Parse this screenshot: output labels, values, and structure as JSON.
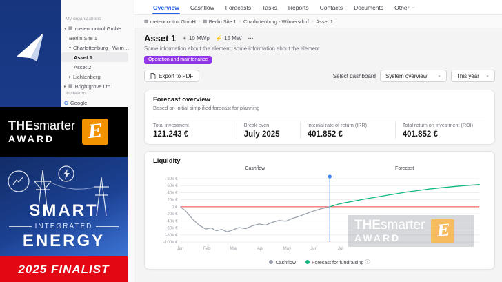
{
  "icons": {
    "building": "▦",
    "sun": "☀",
    "grid": "⚡",
    "more": "⋯",
    "chevron_down": "▾",
    "chevron_right": "▸",
    "caret_down": "⌄",
    "info": "ⓘ",
    "google": "G",
    "separator": "›"
  },
  "colors": {
    "accent": "#2563eb",
    "badge_purple": "#9333ea",
    "brand_blue": "#1e4499",
    "award_orange": "#f39200",
    "award_red": "#e30613",
    "chart_cashflow": "#9ca3af",
    "chart_forecast": "#10b981",
    "chart_today": "#3b82f6",
    "chart_zero": "#ef4444"
  },
  "tabs": {
    "active": "Overview",
    "items": [
      {
        "label": "Overview"
      },
      {
        "label": "Cashflow"
      },
      {
        "label": "Forecasts"
      },
      {
        "label": "Tasks"
      },
      {
        "label": "Reports"
      },
      {
        "label": "Contacts"
      },
      {
        "label": "Documents"
      },
      {
        "label": "Other",
        "caret": true
      }
    ]
  },
  "breadcrumb": {
    "items": [
      {
        "label": "meteocontrol GmbH",
        "icon": "building"
      },
      {
        "label": "Berlin Site 1",
        "icon": "building"
      },
      {
        "label": "Charlottenburg - Wilmersdorf"
      },
      {
        "label": "Asset 1"
      }
    ]
  },
  "sidebar": {
    "sections": [
      {
        "label": "My organizations",
        "items": [
          {
            "label": "meteocontrol GmbH",
            "icon": "building",
            "chevron": "down",
            "level": 0
          },
          {
            "label": "Berlin Site 1",
            "level": 1
          },
          {
            "label": "Charlottenburg - Wilme...",
            "chevron": "down",
            "level": 1
          },
          {
            "label": "Asset 1",
            "level": 2,
            "selected": true
          },
          {
            "label": "Asset 2",
            "level": 2
          },
          {
            "label": "Lichtenberg",
            "chevron": "right",
            "level": 1
          },
          {
            "label": "Brightgrove Ltd.",
            "icon": "building",
            "chevron": "right",
            "level": 0
          }
        ]
      },
      {
        "label": "Invitations",
        "items": [
          {
            "label": "Google",
            "icon": "google",
            "level": 0
          }
        ]
      }
    ]
  },
  "page": {
    "title": "Asset 1",
    "specs": [
      {
        "icon": "sun",
        "label": "10 MWp"
      },
      {
        "icon": "grid",
        "label": "15 MW"
      }
    ],
    "description": "Some information about the element, some information about the element",
    "status_badge": "Operation and maintenance"
  },
  "toolbar": {
    "export_pdf_label": "Export to PDF",
    "select_dashboard_label": "Select dashboard",
    "dashboard_value": "System overview",
    "period_value": "This year"
  },
  "forecast_card": {
    "title": "Forecast overview",
    "subtitle": "Based on initial simplified forecast for planning",
    "stats": [
      {
        "label": "Total investment",
        "value": "121.243 €"
      },
      {
        "label": "Break even",
        "value": "July 2025"
      },
      {
        "label": "Internal rate of return (IRR)",
        "value": "401.852 €"
      },
      {
        "label": "Total return on investment (ROI)",
        "value": "401.852 €"
      }
    ]
  },
  "liquidity_card": {
    "title": "Liquidity",
    "region_labels": [
      "Cashflow",
      "Forecast"
    ],
    "legend": [
      {
        "label": "Cashflow",
        "color": "#9ca3af"
      },
      {
        "label": "Forecast for fundraising",
        "color": "#10b981",
        "info": true
      }
    ]
  },
  "chart_data": {
    "type": "line",
    "title": "Liquidity",
    "unit": "EUR (thousands)",
    "x_tick_labels": [
      "Jan",
      "Feb",
      "Mar",
      "Apr",
      "May",
      "Jun",
      "Jul"
    ],
    "x_domain": [
      0,
      11.2
    ],
    "ylim_k": [
      -100,
      80
    ],
    "y_ticks": [
      {
        "v": 80,
        "label": "80k €"
      },
      {
        "v": 60,
        "label": "60k €"
      },
      {
        "v": 40,
        "label": "40k €"
      },
      {
        "v": 20,
        "label": "20k €"
      },
      {
        "v": 0,
        "label": "0 €"
      },
      {
        "v": -20,
        "label": "-20k €"
      },
      {
        "v": -40,
        "label": "-40k €"
      },
      {
        "v": -60,
        "label": "-60k €"
      },
      {
        "v": -80,
        "label": "-80k €"
      },
      {
        "v": -100,
        "label": "-100k €"
      }
    ],
    "zero_line_k": 0,
    "zero_line_color": "#ef4444",
    "today_month": 5.6,
    "today_color": "#3b82f6",
    "series": [
      {
        "name": "Cashflow",
        "color": "#9ca3af",
        "points_month_keur": [
          [
            0,
            0
          ],
          [
            0.2,
            -12
          ],
          [
            0.45,
            -34
          ],
          [
            0.7,
            -52
          ],
          [
            0.95,
            -63
          ],
          [
            1.15,
            -60
          ],
          [
            1.35,
            -68
          ],
          [
            1.55,
            -64
          ],
          [
            1.75,
            -71
          ],
          [
            1.95,
            -66
          ],
          [
            2.2,
            -59
          ],
          [
            2.45,
            -62
          ],
          [
            2.7,
            -54
          ],
          [
            2.95,
            -49
          ],
          [
            3.2,
            -52
          ],
          [
            3.45,
            -44
          ],
          [
            3.7,
            -39
          ],
          [
            3.95,
            -41
          ],
          [
            4.2,
            -33
          ],
          [
            4.45,
            -27
          ],
          [
            4.7,
            -20
          ],
          [
            4.95,
            -13
          ],
          [
            5.25,
            -6
          ],
          [
            5.6,
            0
          ]
        ]
      },
      {
        "name": "Forecast for fundraising",
        "color": "#10b981",
        "points_month_keur": [
          [
            5.6,
            0
          ],
          [
            5.9,
            7
          ],
          [
            6.2,
            12
          ],
          [
            6.5,
            16
          ],
          [
            6.9,
            22
          ],
          [
            7.3,
            27
          ],
          [
            7.7,
            32
          ],
          [
            8.1,
            37
          ],
          [
            8.5,
            42
          ],
          [
            8.9,
            46
          ],
          [
            9.4,
            51
          ],
          [
            9.9,
            55
          ],
          [
            10.5,
            59
          ],
          [
            11.2,
            63
          ]
        ]
      }
    ]
  },
  "award": {
    "brand": {
      "the": "THE",
      "smarter": "smarter",
      "award": "AWARD",
      "logo_letter": "E"
    },
    "middle": {
      "line1": "SMART",
      "line2": "INTEGRATED",
      "line3": "ENERGY"
    },
    "footer": "2025 FINALIST"
  }
}
